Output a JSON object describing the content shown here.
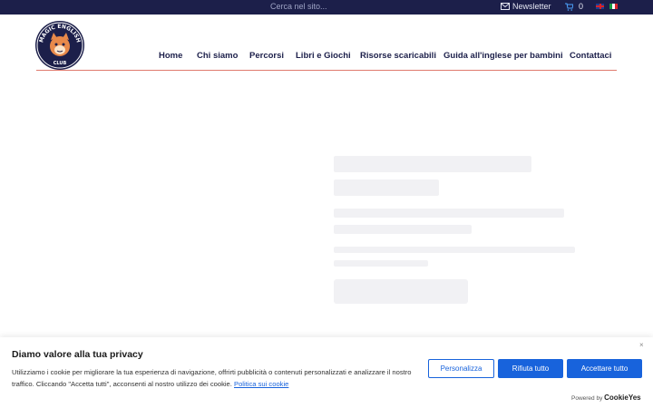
{
  "topbar": {
    "search_placeholder": "Cerca nel sito...",
    "newsletter_label": "Newsletter",
    "cart_count": "0",
    "languages": [
      "en",
      "it"
    ]
  },
  "logo": {
    "text_top": "MAGIC ENGLISH",
    "text_bottom": "CLUB"
  },
  "nav": {
    "items": [
      "Home",
      "Chi siamo",
      "Percorsi",
      "Libri e Giochi",
      "Risorse scaricabili",
      "Guida all'inglese per bambini",
      "Contattaci"
    ]
  },
  "cookie": {
    "title": "Diamo valore alla tua privacy",
    "text": "Utilizziamo i cookie per migliorare la tua esperienza di navigazione, offrirti pubblicità o contenuti personalizzati e analizzare il nostro traffico. Cliccando \"Accetta tutti\", acconsenti al nostro utilizzo dei cookie.",
    "policy_link": "Politica sui cookie",
    "customize_label": "Personalizza",
    "reject_label": "Rifiuta tutto",
    "accept_label": "Accettare tutto",
    "close_symbol": "×",
    "powered_by": "Powered by",
    "brand": "CookieYes"
  },
  "colors": {
    "navy": "#1c1f4a",
    "accent_blue": "#1863dc",
    "divider": "#e07a6e"
  }
}
